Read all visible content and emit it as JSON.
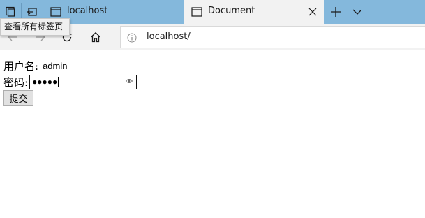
{
  "tabs": [
    {
      "title": "localhost",
      "active": false
    },
    {
      "title": "Document",
      "active": true
    }
  ],
  "tooltip": "查看所有标签页",
  "address": {
    "url": "localhost/"
  },
  "form": {
    "username_label": "用户名:",
    "username_value": "admin",
    "password_label": "密码:",
    "password_masked": "●●●●●",
    "submit_label": "提交"
  },
  "colors": {
    "tabstrip": "#84b8dc",
    "active_tab": "#f2f2f2"
  }
}
